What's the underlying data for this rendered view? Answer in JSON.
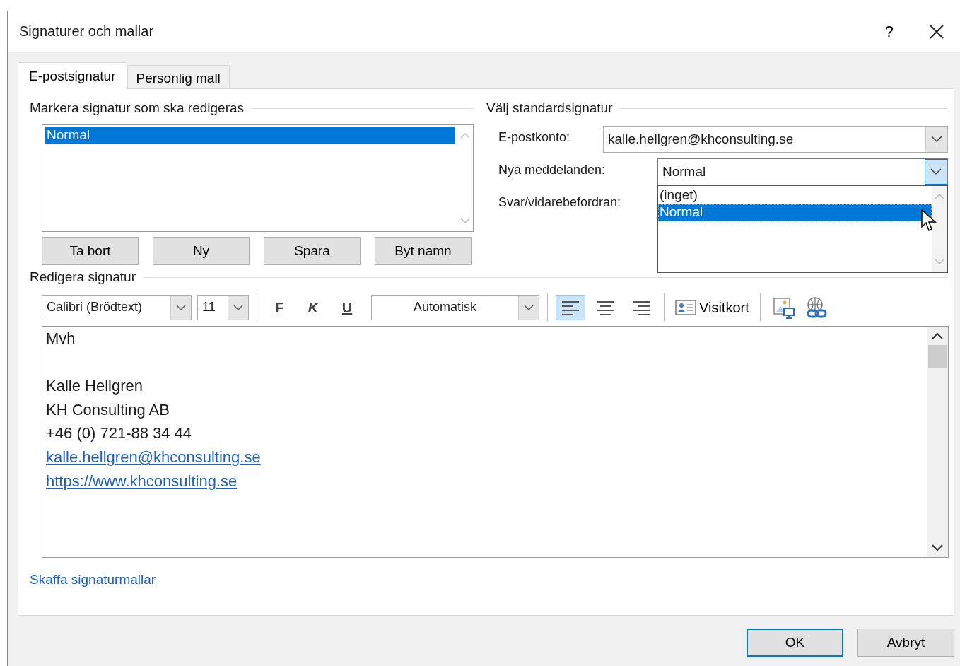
{
  "window": {
    "title": "Signaturer och mallar",
    "help": "?"
  },
  "tabs": [
    {
      "label": "E-postsignatur",
      "selected": true
    },
    {
      "label": "Personlig mall",
      "selected": false
    }
  ],
  "signature_list": {
    "heading": "Markera signatur som ska redigeras",
    "items": [
      {
        "label": "Normal",
        "selected": true
      }
    ]
  },
  "signature_buttons": [
    "Ta bort",
    "Ny",
    "Spara",
    "Byt namn"
  ],
  "defaults": {
    "heading": "Välj standardsignatur",
    "fields": [
      {
        "label": "E-postkonto:",
        "value": "kalle.hellgren@khconsulting.se",
        "expanded": false
      },
      {
        "label": "Nya meddelanden:",
        "value": "Normal",
        "expanded": true,
        "options": [
          {
            "label": "(inget)",
            "selected": false
          },
          {
            "label": "Normal",
            "selected": true
          }
        ]
      },
      {
        "label": "Svar/vidarebefordran:"
      }
    ]
  },
  "editor": {
    "heading": "Redigera signatur",
    "font": "Calibri (Brödtext)",
    "size": "11",
    "bold": "F",
    "italic": "K",
    "underline": "U",
    "font_color": "Automatisk",
    "align": [
      {
        "kind": "left",
        "selected": true
      },
      {
        "kind": "center",
        "selected": false
      },
      {
        "kind": "right",
        "selected": false
      }
    ],
    "business_card": "Visitkort",
    "lines": [
      {
        "kind": "text",
        "text": "Mvh"
      },
      {
        "kind": "blank"
      },
      {
        "kind": "text",
        "text": "Kalle Hellgren"
      },
      {
        "kind": "text",
        "text": "KH Consulting AB"
      },
      {
        "kind": "text",
        "text": "+46 (0) 721-88 34 44"
      },
      {
        "kind": "link",
        "text": "kalle.hellgren@khconsulting.se"
      },
      {
        "kind": "link",
        "text": "https://www.khconsulting.se"
      }
    ]
  },
  "templates_link": "Skaffa signaturmallar",
  "buttons": [
    {
      "label": "OK",
      "default": true
    },
    {
      "label": "Avbryt",
      "default": false
    }
  ]
}
